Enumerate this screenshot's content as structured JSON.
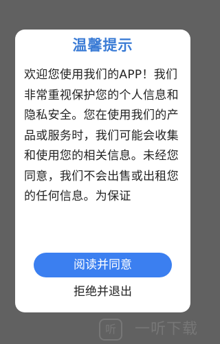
{
  "dialog": {
    "title": "温馨提示",
    "body": "欢迎您使用我们的APP！我们非常重视保护您的个人信息和隐私安全。您在使用我们的产品或服务时，我们可能会收集和使用您的相关信息。未经您同意，我们不会出售或出租您的任何信息。为保证",
    "agree_label": "阅读并同意",
    "reject_label": "拒绝并退出"
  },
  "watermark": {
    "logo_glyph": "听",
    "text": "一听下载"
  },
  "colors": {
    "accent": "#3b7ff0",
    "title": "#3a7bd5",
    "overlay": "#616161"
  }
}
